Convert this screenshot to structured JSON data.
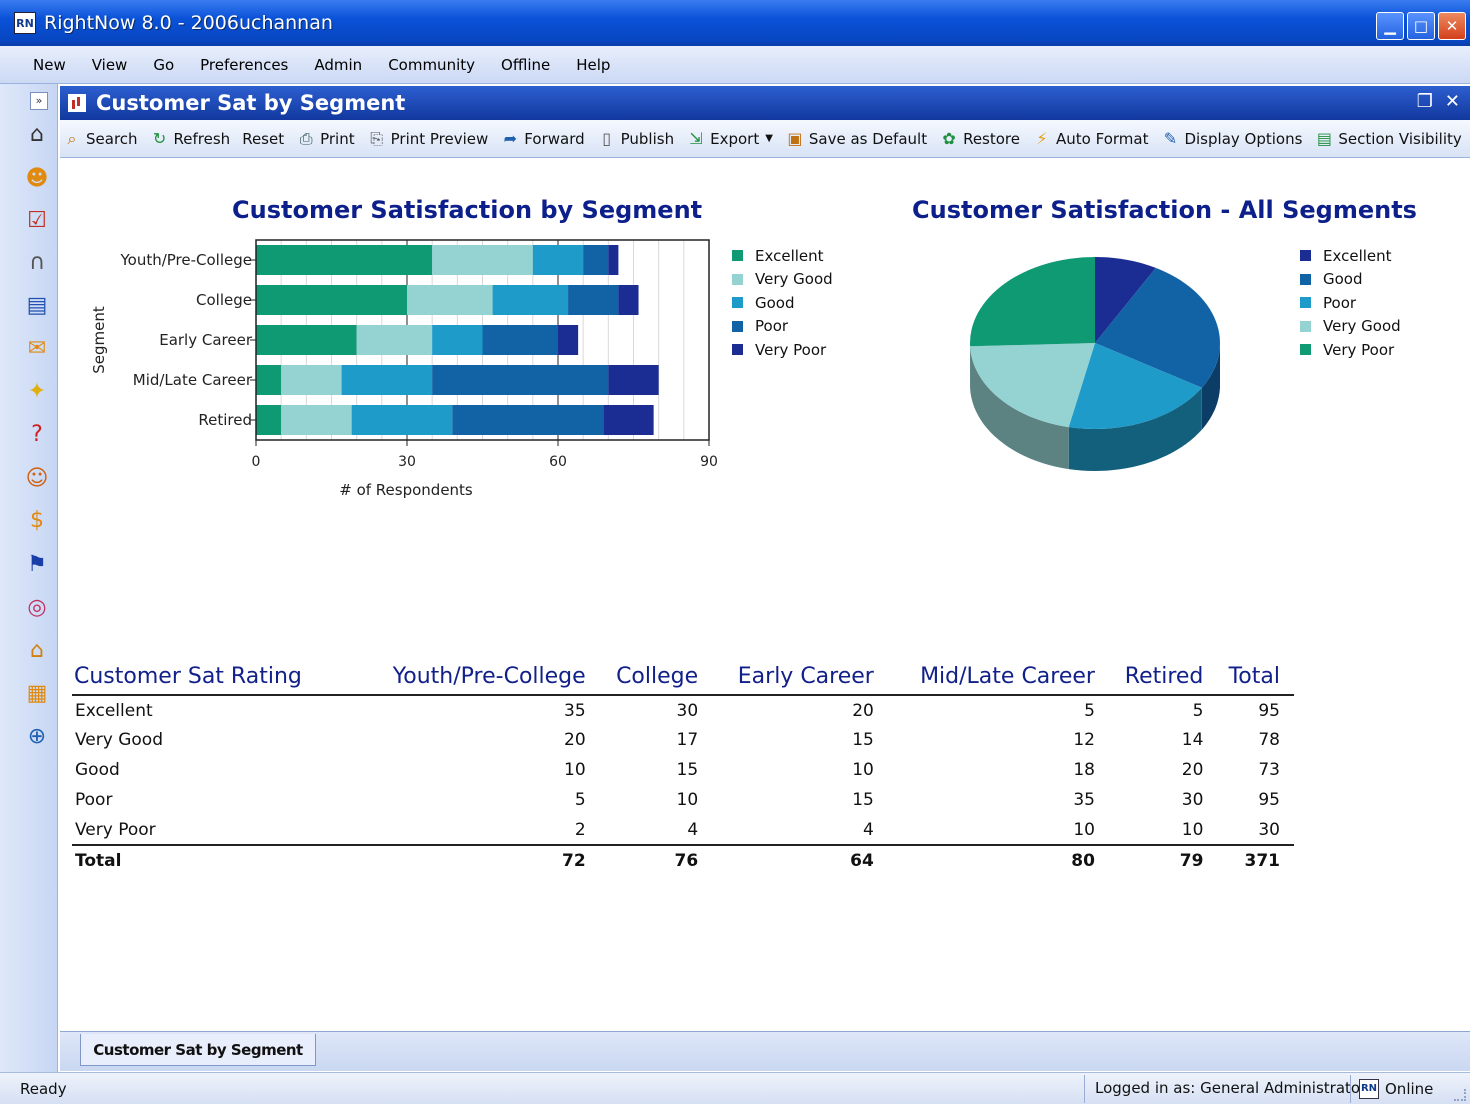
{
  "window": {
    "title": "RightNow 8.0 - 2006uchannan",
    "app_icon": "RN"
  },
  "menu": [
    "New",
    "View",
    "Go",
    "Preferences",
    "Admin",
    "Community",
    "Offline",
    "Help"
  ],
  "report": {
    "title": "Customer Sat by Segment"
  },
  "toolbar": [
    {
      "label": "Search",
      "icon": "magnifier-icon"
    },
    {
      "label": "Refresh",
      "icon": "refresh-icon"
    },
    {
      "label": "Reset",
      "icon": ""
    },
    {
      "label": "Print",
      "icon": "printer-icon"
    },
    {
      "label": "Print Preview",
      "icon": "print-preview-icon"
    },
    {
      "label": "Forward",
      "icon": "forward-icon"
    },
    {
      "label": "Publish",
      "icon": "publish-icon"
    },
    {
      "label": "Export",
      "icon": "export-icon"
    },
    {
      "label": "Save as Default",
      "icon": "save-default-icon"
    },
    {
      "label": "Restore",
      "icon": "restore-icon"
    },
    {
      "label": "Auto Format",
      "icon": "auto-format-icon"
    },
    {
      "label": "Display Options",
      "icon": "display-options-icon"
    },
    {
      "label": "Section Visibility",
      "icon": "section-visibility-icon"
    }
  ],
  "colors": {
    "excellent": "#0f9a74",
    "very_good": "#95d2d2",
    "good": "#1f9bc9",
    "poor": "#1263a6",
    "very_poor": "#1b2d92",
    "title": "#0c1f8a"
  },
  "chart_data": [
    {
      "type": "bar",
      "orientation": "horizontal",
      "stacked": true,
      "title": "Customer Satisfaction by Segment",
      "xlabel": "# of Respondents",
      "ylabel": "Segment",
      "xlim": [
        0,
        90
      ],
      "xticks": [
        "0",
        "30",
        "60",
        "90"
      ],
      "categories": [
        "Youth/Pre-College",
        "College",
        "Early Career",
        "Mid/Late Career",
        "Retired"
      ],
      "series": [
        {
          "name": "Excellent",
          "values": [
            35,
            30,
            20,
            5,
            5
          ]
        },
        {
          "name": "Very Good",
          "values": [
            20,
            17,
            15,
            12,
            14
          ]
        },
        {
          "name": "Good",
          "values": [
            10,
            15,
            10,
            18,
            20
          ]
        },
        {
          "name": "Poor",
          "values": [
            5,
            10,
            15,
            35,
            30
          ]
        },
        {
          "name": "Very Poor",
          "values": [
            2,
            4,
            4,
            10,
            10
          ]
        }
      ],
      "legend": [
        "Excellent",
        "Very Good",
        "Good",
        "Poor",
        "Very Poor"
      ],
      "legend_position": "right",
      "grid": true
    },
    {
      "type": "pie",
      "title": "Customer Satisfaction - All Segments",
      "labels": [
        "Excellent",
        "Good",
        "Poor",
        "Very Good",
        "Very Poor"
      ],
      "values": [
        95,
        73,
        95,
        78,
        30
      ],
      "legend": [
        "Excellent",
        "Good",
        "Poor",
        "Very Good",
        "Very Poor"
      ],
      "legend_position": "right",
      "style": "3d"
    }
  ],
  "table": {
    "headers": [
      "Customer Sat Rating",
      "Youth/Pre-College",
      "College",
      "Early Career",
      "Mid/Late Career",
      "Retired",
      "Total"
    ],
    "rows": [
      [
        "Excellent",
        "35",
        "30",
        "20",
        "5",
        "5",
        "95"
      ],
      [
        "Very Good",
        "20",
        "17",
        "15",
        "12",
        "14",
        "78"
      ],
      [
        "Good",
        "10",
        "15",
        "10",
        "18",
        "20",
        "73"
      ],
      [
        "Poor",
        "5",
        "10",
        "15",
        "35",
        "30",
        "95"
      ],
      [
        "Very Poor",
        "2",
        "4",
        "4",
        "10",
        "10",
        "30"
      ]
    ],
    "total": [
      "Total",
      "72",
      "76",
      "64",
      "80",
      "79",
      "371"
    ]
  },
  "tabs": [
    {
      "label": "Customer Sat by Segment",
      "active": true
    }
  ],
  "status": {
    "left": "Ready",
    "user": "Logged in as: General Administrator",
    "online": "Online",
    "online_icon": "RN"
  }
}
